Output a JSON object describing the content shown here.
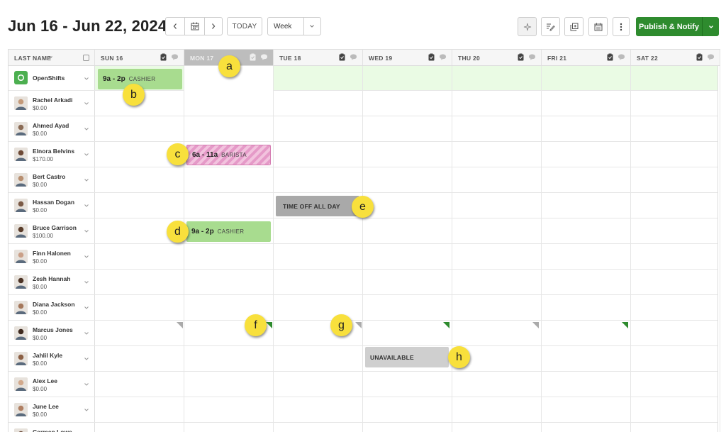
{
  "header": {
    "date_range": "Jun 16 - Jun 22, 2024",
    "today_label": "TODAY",
    "view_value": "Week",
    "publish_label": "Publish & Notify"
  },
  "columns": {
    "name_header": "LAST NAME",
    "days": [
      "SUN 16",
      "MON 17",
      "TUE 18",
      "WED 19",
      "THU 20",
      "FRI 21",
      "SAT 22"
    ],
    "today_index": 1
  },
  "open_shifts": {
    "label": "OpenShifts",
    "shift": {
      "time": "9a - 2p",
      "role": "CASHIER"
    }
  },
  "employees": [
    {
      "name": "Rachel Arkadi",
      "wage": "$0.00"
    },
    {
      "name": "Ahmed Ayad",
      "wage": "$0.00"
    },
    {
      "name": "Elnora Belvins",
      "wage": "$170.00"
    },
    {
      "name": "Bert Castro",
      "wage": "$0.00"
    },
    {
      "name": "Hassan Dogan",
      "wage": "$0.00"
    },
    {
      "name": "Bruce Garrison",
      "wage": "$100.00"
    },
    {
      "name": "Finn Halonen",
      "wage": "$0.00"
    },
    {
      "name": "Zesh Hannah",
      "wage": "$0.00"
    },
    {
      "name": "Diana Jackson",
      "wage": "$0.00"
    },
    {
      "name": "Marcus Jones",
      "wage": "$0.00"
    },
    {
      "name": "Jahlil Kyle",
      "wage": "$0.00"
    },
    {
      "name": "Alex Lee",
      "wage": "$0.00"
    },
    {
      "name": "June Lee",
      "wage": "$0.00"
    },
    {
      "name": "Carmen Lowe",
      "wage": ""
    }
  ],
  "shifts": {
    "elnora": {
      "time": "6a - 11a",
      "role": "BARISTA"
    },
    "bruce": {
      "time": "9a - 2p",
      "role": "CASHIER"
    },
    "hassan_timeoff": "TIME OFF ALL DAY",
    "jahlil_unavailable": "UNAVAILABLE"
  },
  "markers": [
    "a",
    "b",
    "c",
    "d",
    "e",
    "f",
    "g",
    "h"
  ],
  "colors": {
    "publish": "#2e8b2e",
    "open_row": "#eafbe4",
    "shift_green": "#a8dc8f",
    "shift_pink": "#e59ac8",
    "marker": "#f8e03c"
  }
}
